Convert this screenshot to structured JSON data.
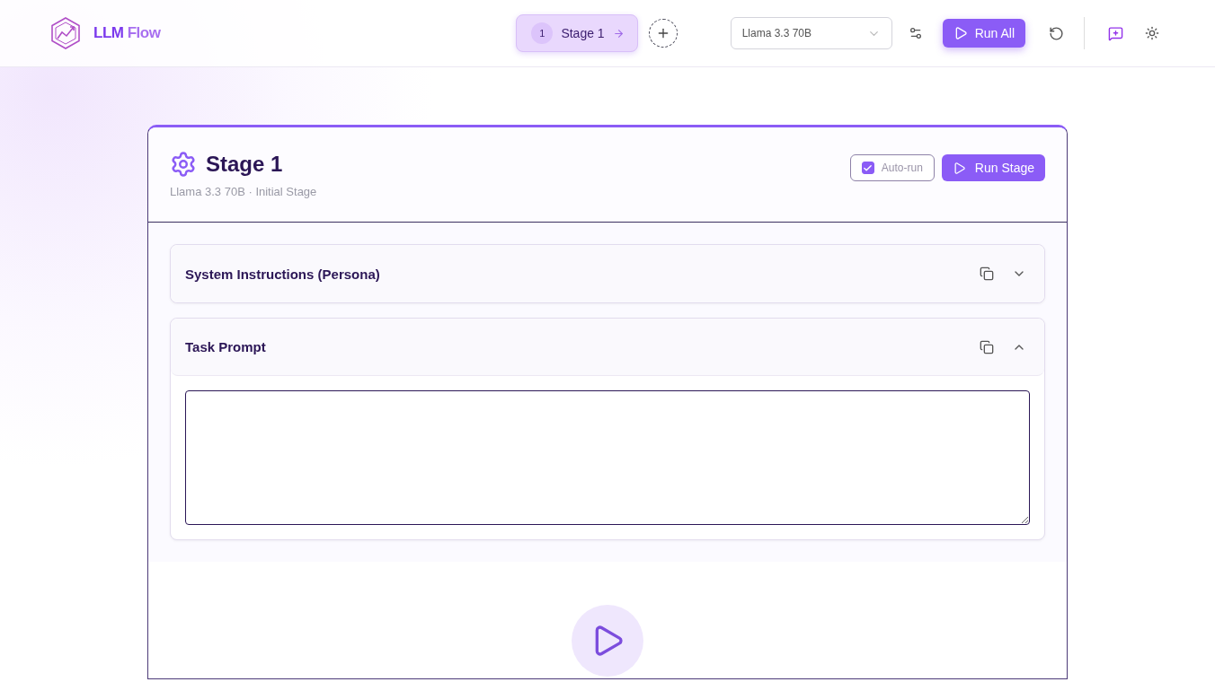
{
  "brand": {
    "name_bold": "LLM",
    "name_light": "Flow"
  },
  "stage_tabs": [
    {
      "number": "1",
      "label": "Stage 1",
      "selected": true
    }
  ],
  "model_select": {
    "value": "Llama 3.3 70B"
  },
  "run_all": "Run All",
  "stage": {
    "title": "Stage 1",
    "subtitle": "Llama 3.3 70B · Initial Stage",
    "auto_run": {
      "label": "Auto-run",
      "checked": true
    },
    "run_button": "Run Stage",
    "sections": [
      {
        "title": "System Instructions (Persona)",
        "expanded": false
      },
      {
        "title": "Task Prompt",
        "expanded": true
      }
    ]
  }
}
